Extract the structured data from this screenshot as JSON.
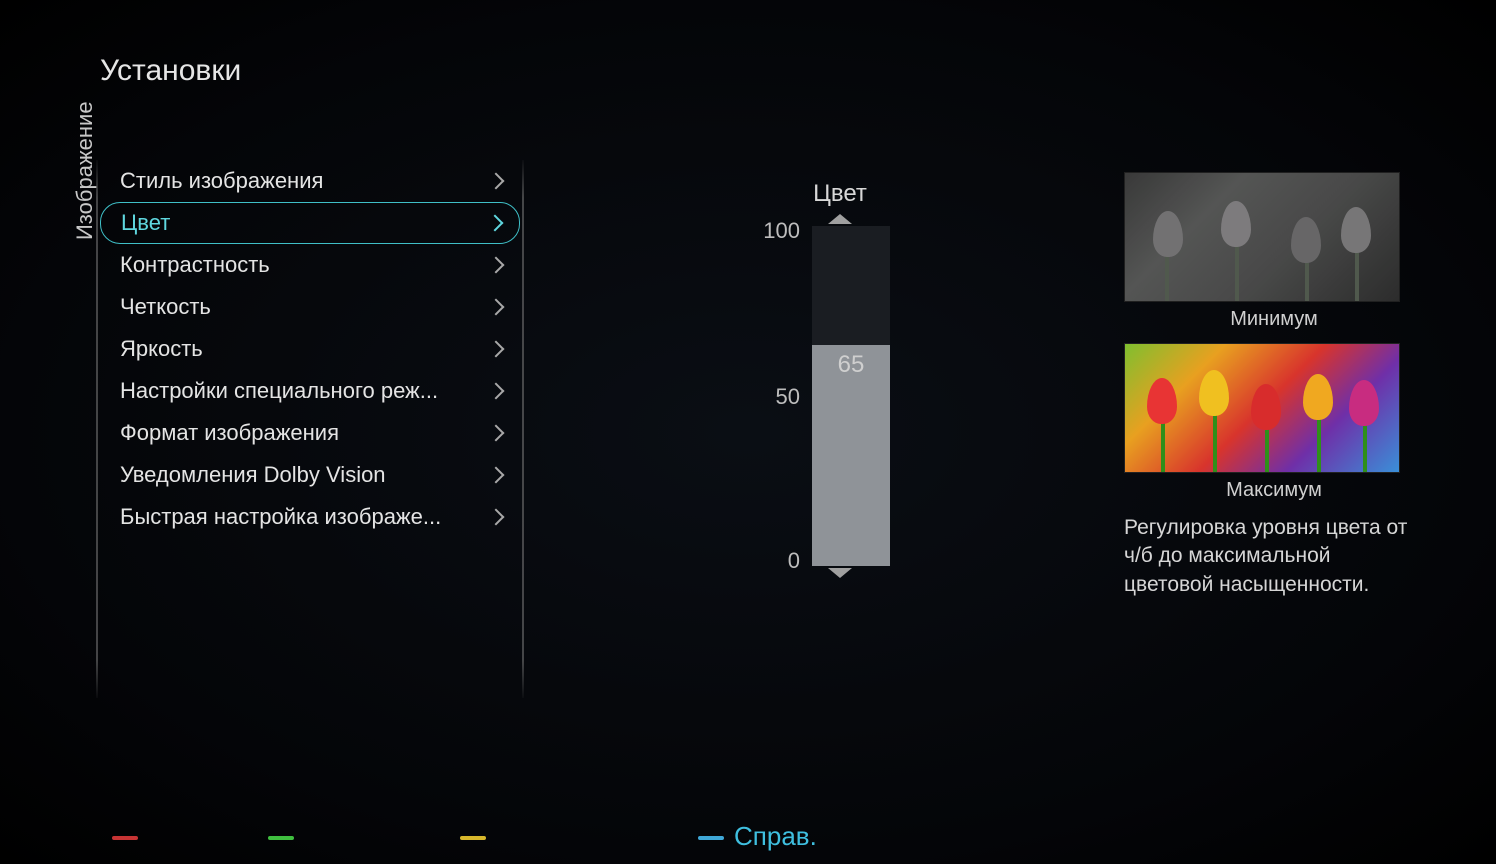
{
  "page_title": "Установки",
  "category_label": "Изображение",
  "menu": {
    "items": [
      {
        "label": "Стиль изображения"
      },
      {
        "label": "Цвет",
        "selected": true
      },
      {
        "label": "Контрастность"
      },
      {
        "label": "Четкость"
      },
      {
        "label": "Яркость"
      },
      {
        "label": "Настройки специального реж..."
      },
      {
        "label": "Формат изображения"
      },
      {
        "label": "Уведомления Dolby Vision"
      },
      {
        "label": "Быстрая настройка изображе..."
      }
    ]
  },
  "slider": {
    "title": "Цвет",
    "max_label": "100",
    "mid_label": "50",
    "min_label": "0",
    "value": 65,
    "max": 100,
    "min": 0
  },
  "preview": {
    "min_label": "Минимум",
    "max_label": "Максимум",
    "description": "Регулировка уровня цвета от ч/б до максимальной цветовой насыщенности."
  },
  "bottom": {
    "help_label": "Справ."
  }
}
